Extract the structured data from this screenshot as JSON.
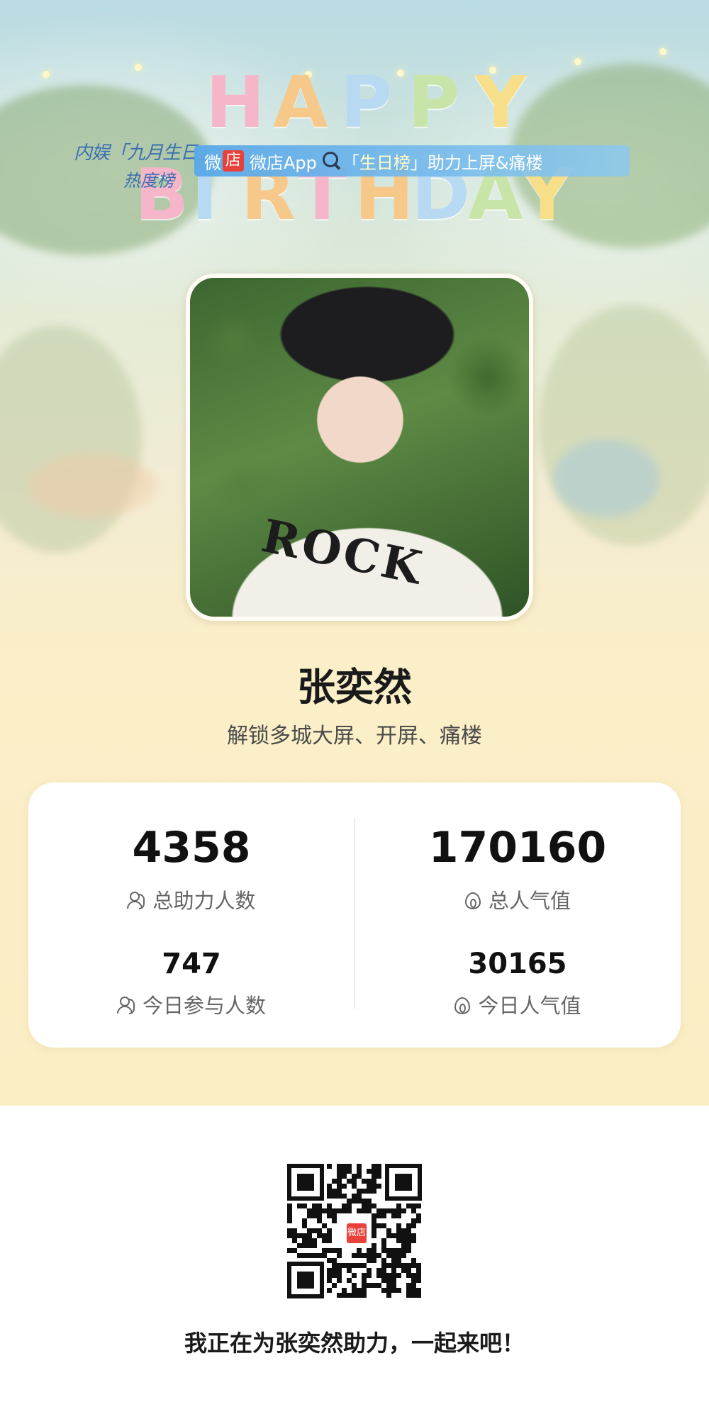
{
  "banner": {
    "logo_line1": "内娱「九月生日」",
    "logo_line2": "热度榜",
    "shop_prefix": "微",
    "shop_badge": "店",
    "app_name": "微店App",
    "quote_open": "「",
    "keyword": "生日榜",
    "quote_close": "」",
    "action": "助力上屏&痛楼"
  },
  "hero": {
    "happy_letters": [
      "H",
      "A",
      "P",
      "P",
      "Y"
    ],
    "birthday_letters": [
      "B",
      "I",
      "R",
      "T",
      "H",
      "D",
      "A",
      "Y"
    ],
    "letter_colors": [
      "#f5b6c9",
      "#f6c98a",
      "#b8d9f2",
      "#c9e4a8",
      "#f7df8a",
      "#f5b6c9",
      "#b8d9f2",
      "#f6c98a"
    ],
    "shirt_print": "ROCK"
  },
  "profile": {
    "name": "张奕然",
    "tagline": "解锁多城大屏、开屏、痛楼"
  },
  "stats": {
    "total_supporters": {
      "value": "4358",
      "label": "总助力人数",
      "icon": "user-icon"
    },
    "total_popularity": {
      "value": "170160",
      "label": "总人气值",
      "icon": "fire-icon"
    },
    "today_participants": {
      "value": "747",
      "label": "今日参与人数",
      "icon": "user-icon"
    },
    "today_popularity": {
      "value": "30165",
      "label": "今日人气值",
      "icon": "fire-icon"
    }
  },
  "footer": {
    "qr_center_label": "微店",
    "invite_text": "我正在为张奕然助力，一起来吧！"
  },
  "colors": {
    "accent_red": "#e8403a",
    "ribbon_blue": "#58a8e8",
    "background_cream": "#fbedc4"
  }
}
